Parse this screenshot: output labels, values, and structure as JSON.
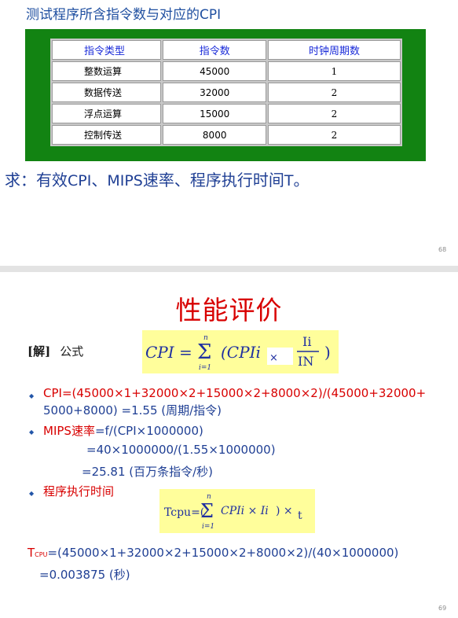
{
  "slide_top": {
    "title": "测试程序所含指令数与对应的CPI",
    "table": {
      "headers": [
        "指令类型",
        "指令数",
        "时钟周期数"
      ],
      "rows": [
        [
          "整数运算",
          "45000",
          "1"
        ],
        [
          "数据传送",
          "32000",
          "2"
        ],
        [
          "浮点运算",
          "15000",
          "2"
        ],
        [
          "控制传送",
          "8000",
          "2"
        ]
      ]
    },
    "question_prefix": "求：有效",
    "question_cpi": "CPI",
    "question_mid": "、",
    "question_mips": "MIPS",
    "question_rest": "速率、程序执行时间",
    "question_t": "T",
    "question_end": "。",
    "page_number": "68"
  },
  "slide_bottom": {
    "title": "性能评价",
    "solution_label": "[解]",
    "formula_label": "公式",
    "formula1": {
      "lhs": "CPI =",
      "sum_top": "n",
      "sum_bottom": "i=1",
      "body": "(CPIi",
      "times": "×",
      "frac_num": "Ii",
      "frac_den": "IN",
      "close": ")"
    },
    "cpi_line_1": "CPI=(45000×1+32000×2+15000×2+8000×2)/(45000+32000+",
    "cpi_line_2": "5000+8000) =1.55 (周期/指令)",
    "mips_label_a": "MIPS",
    "mips_label_b": "速率",
    "mips_line_1": "=f/(CPI×1000000)",
    "mips_line_2": "=40×1000000/(1.55×1000000)",
    "mips_line_3": "=25.81 (百万条指令/秒)",
    "exec_time_label": "程序执行时间",
    "formula2": {
      "lhs": "Tcpu=(",
      "sum_top": "n",
      "sum_bottom": "i=1",
      "body": "CPIi × Ii",
      "close": ") ×",
      "t": "t"
    },
    "tcpu_label": "T",
    "tcpu_sub": "CPU",
    "tcpu_line_1": "=(45000×1+32000×2+15000×2+8000×2)/(40×1000000)",
    "tcpu_line_2": "=0.003875 (秒)",
    "page_number": "69"
  },
  "colors": {
    "title_blue": "#1f4fa0",
    "table_green": "#128312",
    "header_blue": "#1a2bd9",
    "title_red": "#d80000",
    "highlight_yellow": "#fffe9b"
  }
}
